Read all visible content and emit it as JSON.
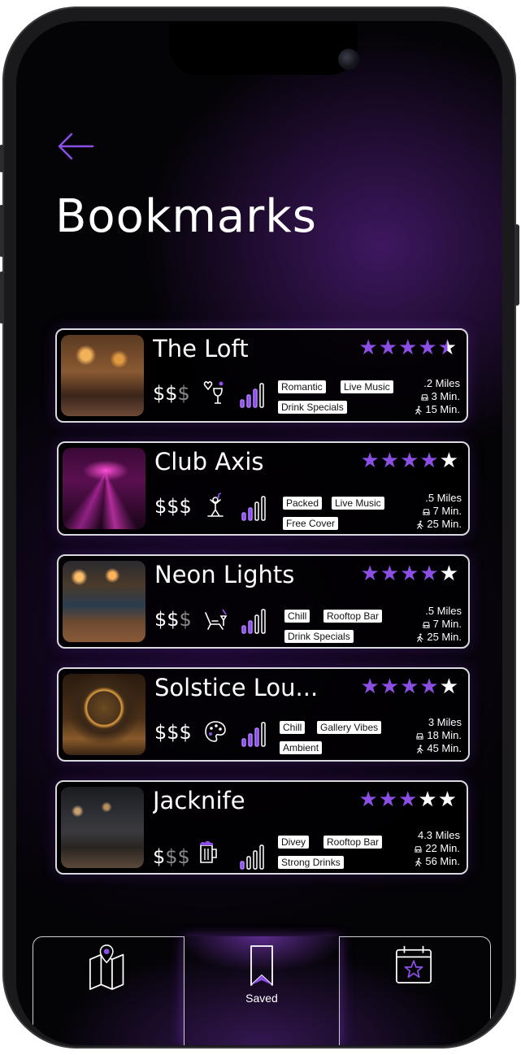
{
  "header": {
    "title": "Bookmarks"
  },
  "colors": {
    "accent": "#8b4fe6",
    "card_border": "#d9d9e0",
    "background": "#040306"
  },
  "venues": [
    {
      "name": "The Loft",
      "rating": 4.5,
      "price_on": "$$",
      "price_off": "$",
      "tags": [
        "Romantic",
        "Live Music",
        "Drink Specials"
      ],
      "vibe_icon": "wine-glass-heart-icon",
      "distance": ".2 Miles",
      "drive": "3 Min.",
      "walk": "15 Min."
    },
    {
      "name": "Club Axis",
      "rating": 4,
      "price_on": "$$$",
      "price_off": "",
      "tags": [
        "Packed",
        "Live Music",
        "Free Cover"
      ],
      "vibe_icon": "dancing-person-icon",
      "distance": ".5 Miles",
      "drive": "7 Min.",
      "walk": "25 Min."
    },
    {
      "name": "Neon Lights",
      "rating": 4,
      "price_on": "$$",
      "price_off": "$",
      "tags": [
        "Chill",
        "Rooftop Bar",
        "Drink Specials"
      ],
      "vibe_icon": "lounge-chair-drink-icon",
      "distance": ".5 Miles",
      "drive": "7 Min.",
      "walk": "25 Min."
    },
    {
      "name": "Solstice Lou...",
      "rating": 4,
      "price_on": "$$$",
      "price_off": "",
      "tags": [
        "Chill",
        "Gallery Vibes",
        "Ambient"
      ],
      "vibe_icon": "palette-icon",
      "distance": "3 Miles",
      "drive": "18 Min.",
      "walk": "45 Min."
    },
    {
      "name": "Jacknife",
      "rating": 3,
      "price_on": "$",
      "price_off": "$$",
      "tags": [
        "Divey",
        "Rooftop Bar",
        "Strong Drinks"
      ],
      "vibe_icon": "beer-mug-icon",
      "distance": "4.3 Miles",
      "drive": "22 Min.",
      "walk": "56 Min."
    }
  ],
  "tabbar": {
    "left_icon": "map-pin-icon",
    "center_label": "Saved",
    "center_icon": "bookmark-icon",
    "right_icon": "calendar-star-icon"
  }
}
